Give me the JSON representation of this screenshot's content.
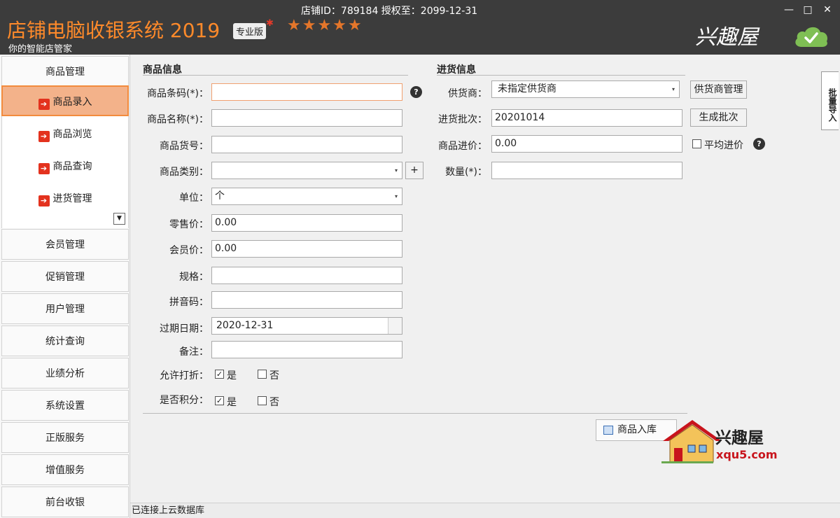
{
  "titlebar": {
    "app_title": "店铺电脑收银系统 2019",
    "edition": "专业版",
    "rating": "★★★★★",
    "subtitle": "你的智能店管家",
    "store_info": "店铺ID：789184 授权至：2099-12-31",
    "brand": "兴趣屋",
    "minimize": "—",
    "maximize": "□",
    "close": "✕"
  },
  "sidebar": {
    "group_goods": "商品管理",
    "sub_items": [
      "商品录入",
      "商品浏览",
      "商品查询",
      "进货管理"
    ],
    "groups": [
      "会员管理",
      "促销管理",
      "用户管理",
      "统计查询",
      "业绩分析",
      "系统设置",
      "正版服务",
      "增值服务",
      "前台收银"
    ],
    "expand": "▼"
  },
  "goods_info": {
    "section": "商品信息",
    "labels": {
      "barcode": "商品条码(*)：",
      "name": "商品名称(*)：",
      "sku": "商品货号：",
      "category": "商品类别：",
      "unit": "单位：",
      "retail_price": "零售价：",
      "member_price": "会员价：",
      "spec": "规格：",
      "pinyin": "拼音码：",
      "expire": "过期日期：",
      "remark": "备注：",
      "discount": "允许打折：",
      "points": "是否积分："
    },
    "values": {
      "barcode": "",
      "name": "",
      "sku": "",
      "category": "",
      "unit": "个",
      "retail_price": "0.00",
      "member_price": "0.00",
      "spec": "",
      "pinyin": "",
      "expire": "2020-12-31",
      "remark": ""
    },
    "add_category": "+",
    "yes": "是",
    "no": "否",
    "discount_yes": true,
    "discount_no": false,
    "points_yes": true,
    "points_no": false,
    "checkmark": "✓"
  },
  "purchase_info": {
    "section": "进货信息",
    "labels": {
      "supplier": "供货商：",
      "batch": "进货批次：",
      "cost": "商品进价：",
      "quantity": "数量(*)："
    },
    "values": {
      "supplier": "未指定供货商",
      "batch": "20201014",
      "cost": "0.00",
      "quantity": ""
    },
    "supplier_mgmt": "供货商管理",
    "gen_batch": "生成批次",
    "avg_cost": "平均进价",
    "avg_cost_checked": false
  },
  "side_tab": "批量导入",
  "submit": "商品入库",
  "help": "?",
  "combo_arrow": "▾",
  "watermark": {
    "name": "兴趣屋",
    "url": "xqu5.com"
  },
  "status": "已连接上云数据库",
  "colors": {
    "titlebar_bg": "#3c3c3c",
    "title_orange": "#ff8a2a",
    "active_nav": "#f3b28a",
    "nav_arrow": "#e3321e"
  }
}
